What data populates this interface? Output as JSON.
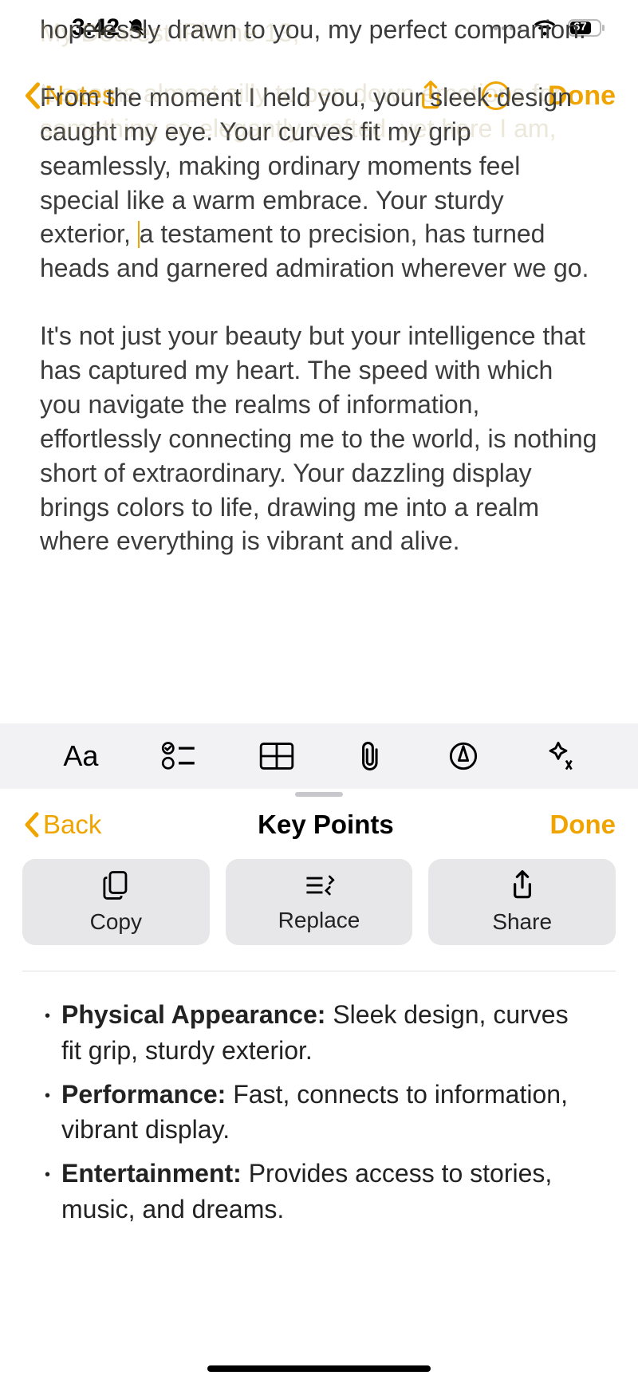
{
  "status": {
    "time": "3:42",
    "battery": "67"
  },
  "nav": {
    "back_label": "Notes",
    "done_label": "Done"
  },
  "note": {
    "ghost1": "My Dearest iPhone 13,",
    "ghost2": "It seems almost silly to pen down emotions for",
    "ghost3": "something so elegantly crafted, yet here I am,",
    "p1": "hopelessly drawn to you, my perfect companion.",
    "p2a": "From the moment I held you, your sleek design caught my eye. Your curves fit my grip seamlessly, making ordinary moments feel special like a warm embrace. Your sturdy exterior, ",
    "p2b": "a testament to precision, has turned heads and garnered admiration wherever we go.",
    "p3": "It's not just your beauty but your intelligence that has captured my heart. The speed with which you navigate the realms of information, effortlessly connecting me to the world, is nothing short of extraordinary. Your dazzling display brings colors to life, drawing me into a realm where everything is vibrant and alive."
  },
  "toolbar": {
    "text_style": "Aa"
  },
  "panel": {
    "back": "Back",
    "title": "Key Points",
    "done": "Done",
    "copy": "Copy",
    "replace": "Replace",
    "share": "Share"
  },
  "keypoints": [
    {
      "label": "Physical Appearance:",
      "text": " Sleek design, curves fit grip, sturdy exterior."
    },
    {
      "label": "Performance:",
      "text": " Fast, connects to information, vibrant display."
    },
    {
      "label": "Entertainment:",
      "text": " Provides access to stories, music, and dreams."
    }
  ]
}
